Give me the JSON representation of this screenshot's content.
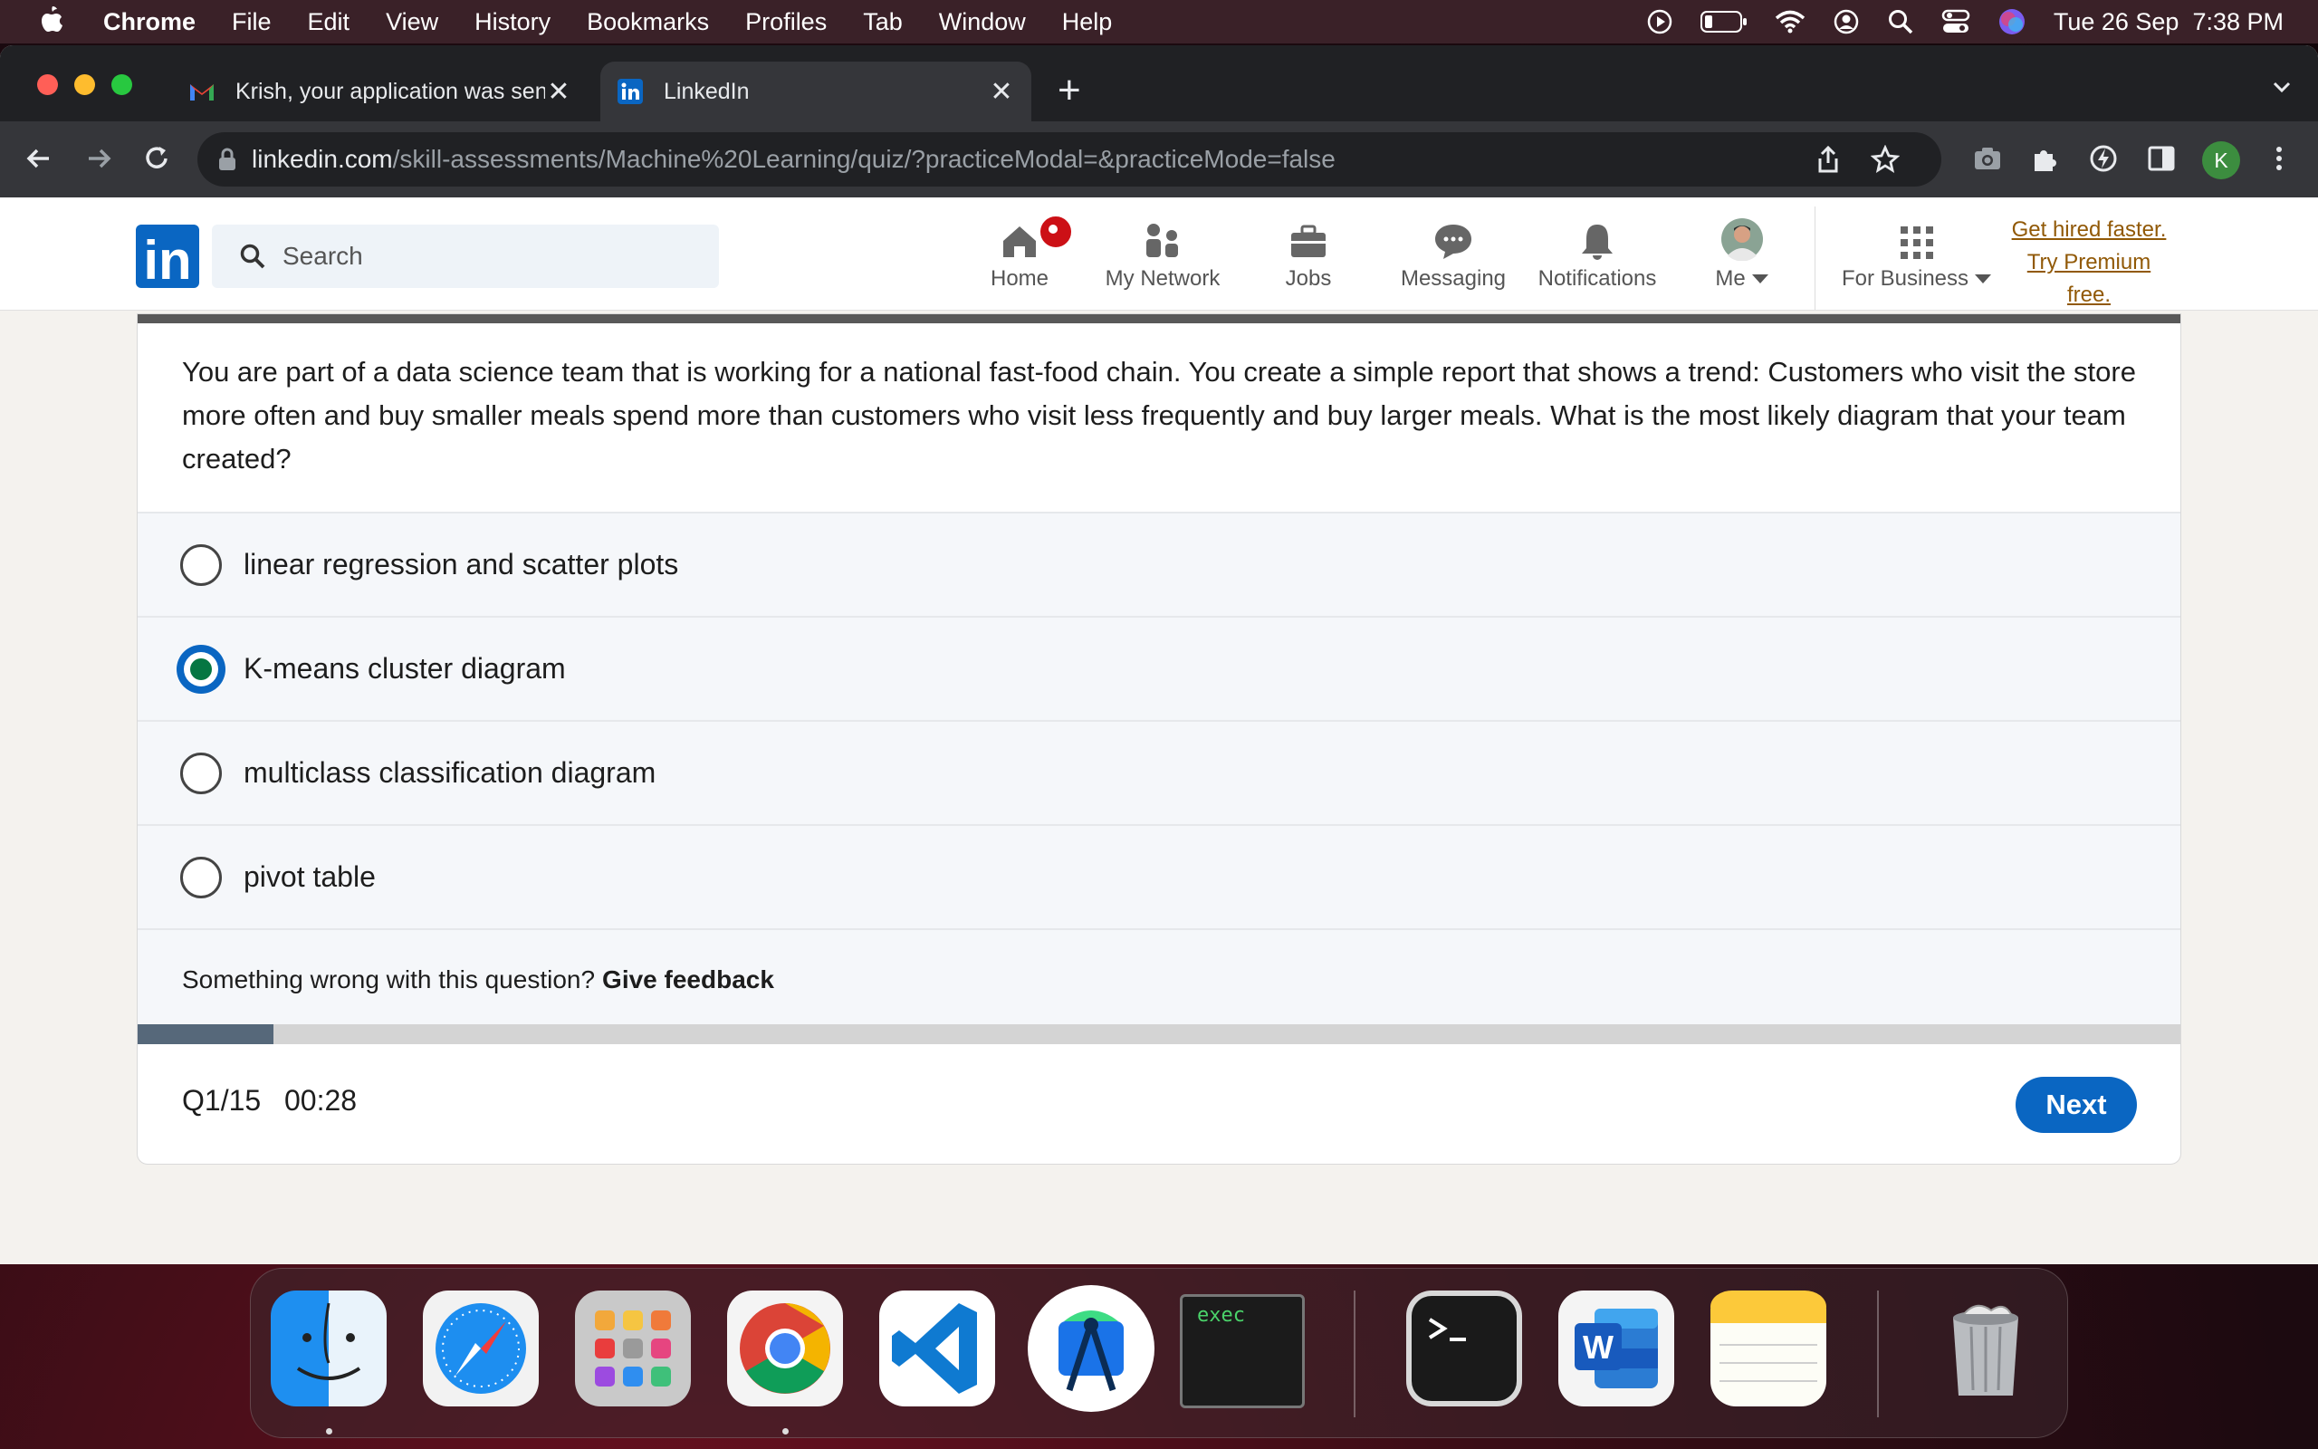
{
  "menubar": {
    "items": [
      "Chrome",
      "File",
      "Edit",
      "View",
      "History",
      "Bookmarks",
      "Profiles",
      "Tab",
      "Window",
      "Help"
    ],
    "clock": "Tue 26 Sep  7:38 PM"
  },
  "browser": {
    "tabs": [
      {
        "title": "Krish, your application was sent to",
        "icon": "gmail-icon"
      },
      {
        "title": "LinkedIn",
        "icon": "linkedin-icon"
      }
    ],
    "url_host": "linkedin.com",
    "url_path": "/skill-assessments/Machine%20Learning/quiz/?practiceModal=&practiceMode=false",
    "profile_initial": "K"
  },
  "linkedin": {
    "search_placeholder": "Search",
    "nav": [
      "Home",
      "My Network",
      "Jobs",
      "Messaging",
      "Notifications",
      "Me",
      "For Business"
    ],
    "premium": [
      "Get hired faster.",
      "Try Premium",
      "free."
    ]
  },
  "quiz": {
    "question": "You are part of a data science team that is working for a national fast-food chain. You create a simple report that shows a trend: Customers who visit the store more often and buy smaller meals spend more than customers who visit less frequently and buy larger meals. What is the most likely diagram that your team created?",
    "options": [
      {
        "label": "linear regression and scatter plots",
        "selected": false
      },
      {
        "label": "K-means cluster diagram",
        "selected": true
      },
      {
        "label": "multiclass classification diagram",
        "selected": false
      },
      {
        "label": "pivot table",
        "selected": false
      }
    ],
    "feedback_prompt": "Something wrong with this question?",
    "feedback_link": "Give feedback",
    "progress": "Q1/15",
    "progress_fraction": 0.0667,
    "timer": "00:28",
    "next_label": "Next"
  },
  "dock": {
    "apps": [
      "Finder",
      "Safari",
      "Launchpad",
      "Google Chrome",
      "Visual Studio Code",
      "Android Studio",
      "exec",
      "Terminal",
      "Microsoft Word",
      "Notes",
      "Trash"
    ],
    "exec_label": "exec"
  },
  "colors": {
    "linkedin_blue": "#0a66c2",
    "selected_green": "#057642",
    "premium_gold": "#915907"
  }
}
